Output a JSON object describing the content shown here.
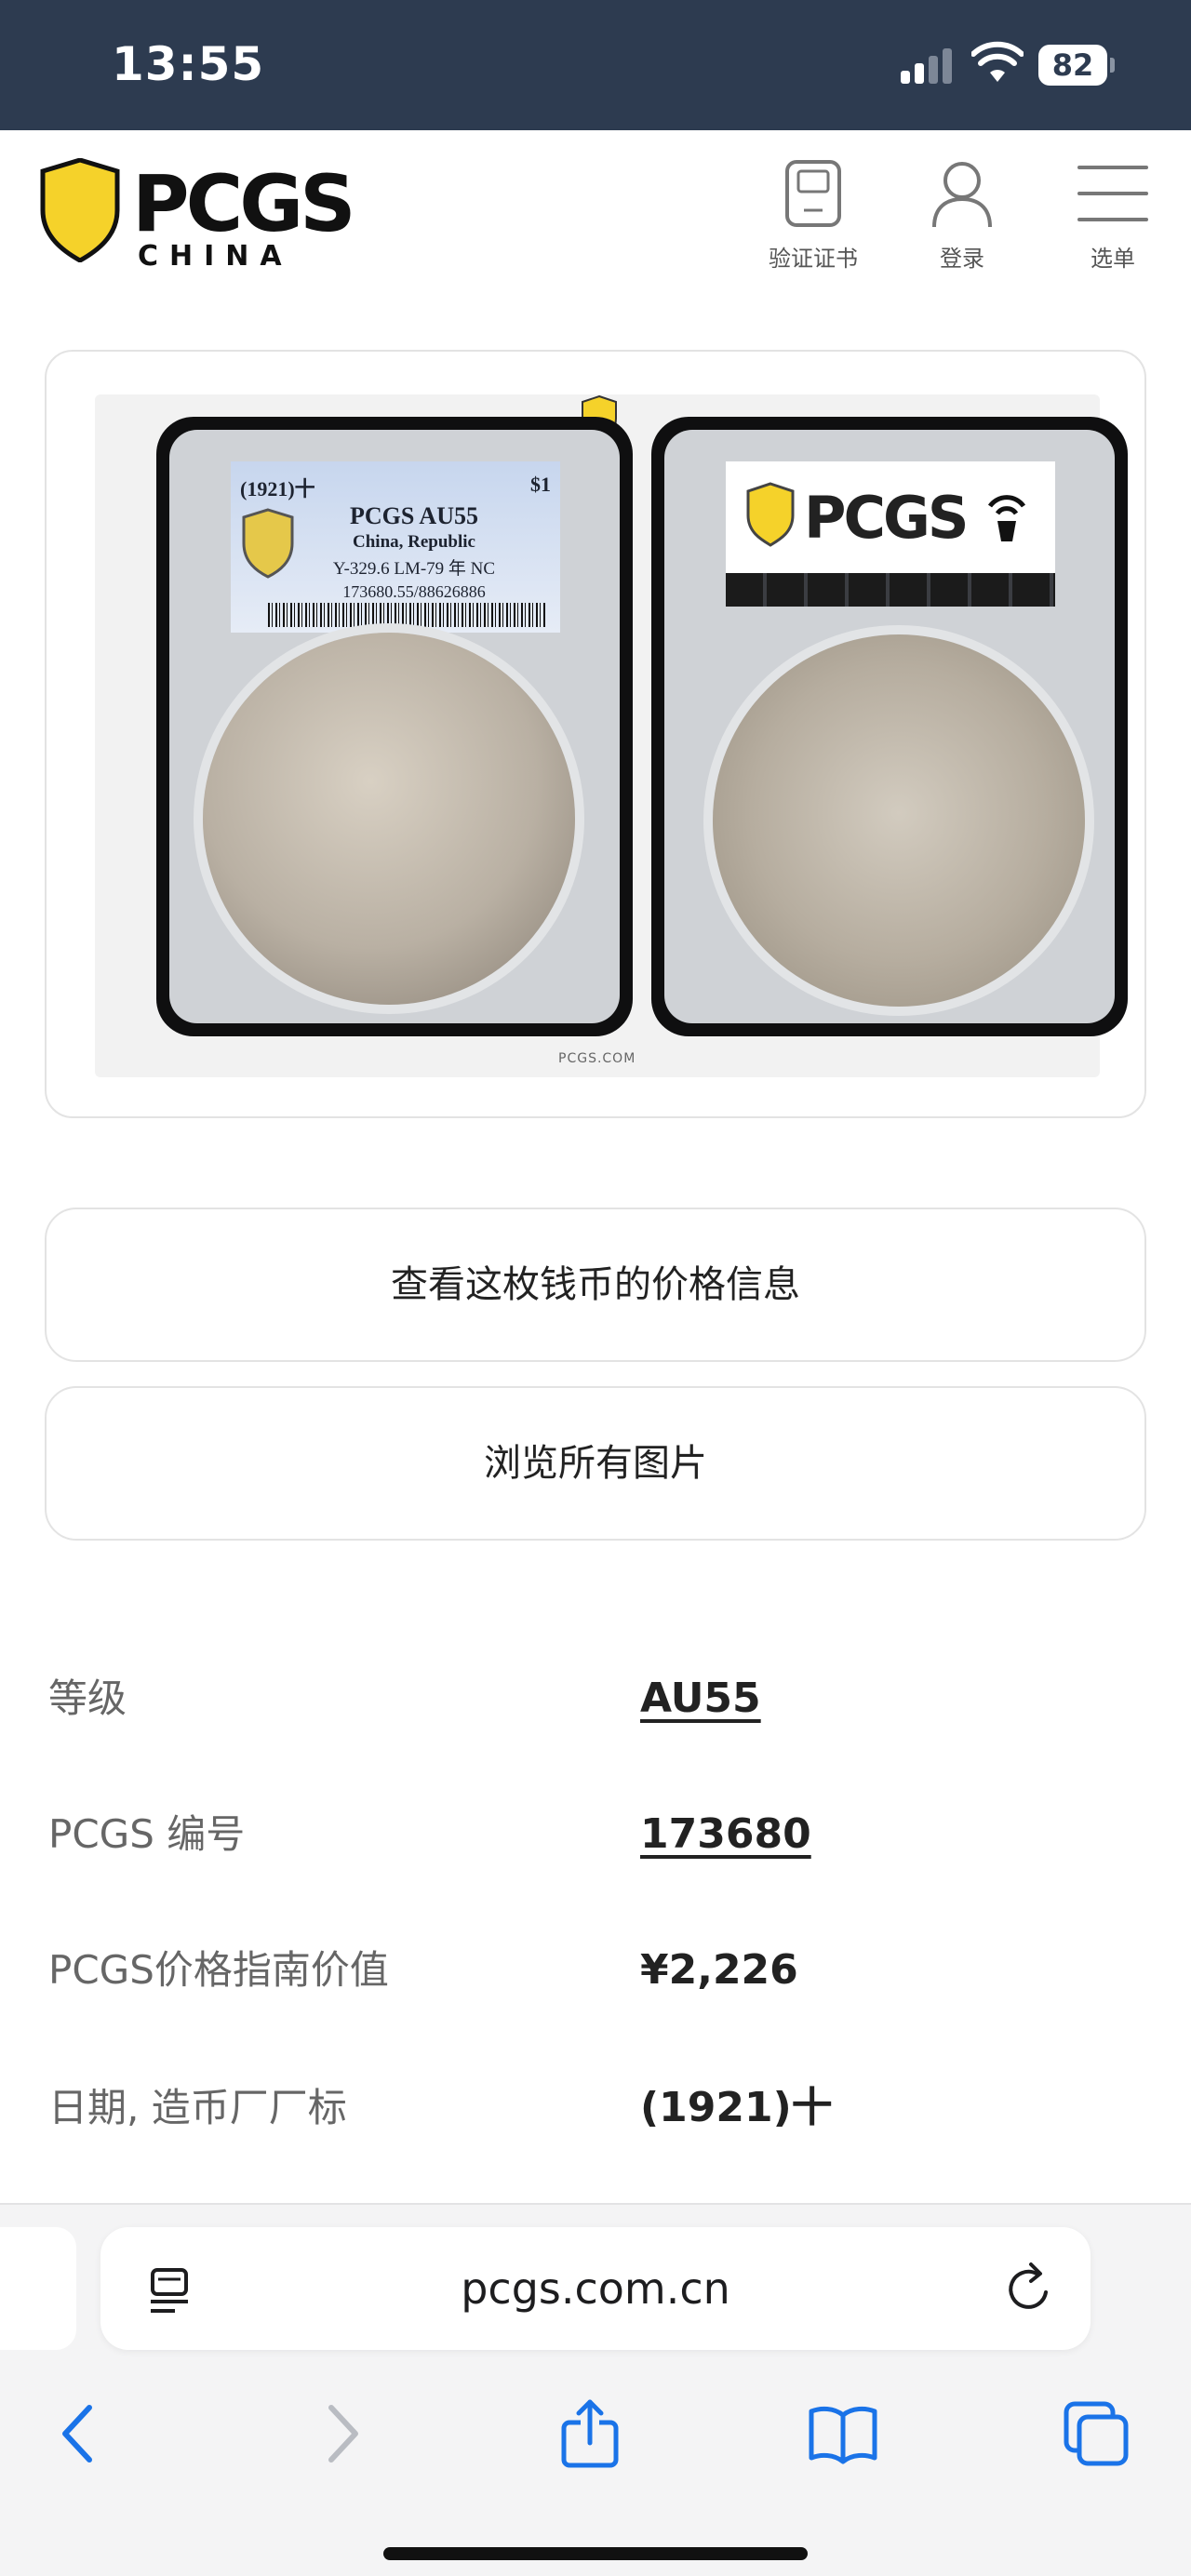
{
  "status_bar": {
    "time": "13:55",
    "battery": "82"
  },
  "header": {
    "logo_text": "PCGS",
    "logo_sub": "CHINA",
    "nav": {
      "verify_label": "验证证书",
      "login_label": "登录",
      "menu_label": "选单"
    }
  },
  "coin_image": {
    "label_date": "(1921)十",
    "label_denom": "$1",
    "label_grade": "PCGS AU55",
    "label_country": "China, Republic",
    "label_ref": "Y-329.6 LM-79 年 NC",
    "label_cert": "173680.55/88626886",
    "back_label_text": "PCGS",
    "site_caption": "PCGS.COM"
  },
  "buttons": {
    "price_info": "查看这枚钱币的价格信息",
    "browse_images": "浏览所有图片"
  },
  "details": [
    {
      "label": "等级",
      "value": "AU55"
    },
    {
      "label": "PCGS 编号",
      "value": "173680"
    },
    {
      "label": "PCGS价格指南价值",
      "value": "¥2,226"
    },
    {
      "label": "日期, 造币厂厂标",
      "value": "(1921)十"
    }
  ],
  "safari": {
    "address": "pcgs.com.cn"
  },
  "colors": {
    "status_bar_bg": "#2d3b50",
    "logo_yellow": "#f5d22a",
    "safari_blue": "#1a73e8"
  }
}
